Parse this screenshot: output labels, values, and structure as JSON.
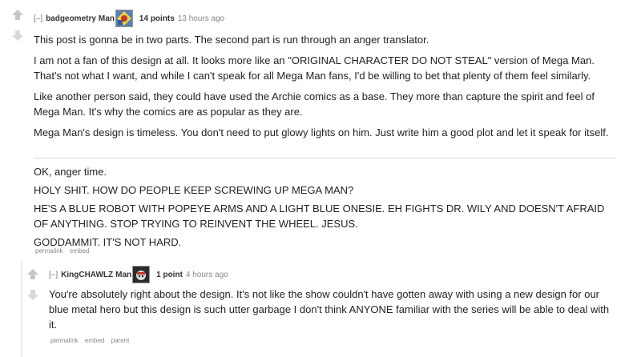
{
  "comment1": {
    "expand": "[–]",
    "author": "badgeometry",
    "flair_text": "Man",
    "score": "14 points",
    "time": "13 hours ago",
    "paragraphs": [
      "This post is gonna be in two parts. The second part is run through an anger translator.",
      "I am not a fan of this design at all. It looks more like an \"ORIGINAL CHARACTER DO NOT STEAL\" version of Mega Man. That's not what I want, and while I can't speak for all Mega Man fans, I'd be willing to bet that plenty of them feel similarly.",
      "Like another person said, they could have used the Archie comics as a base. They more than capture the spirit and feel of Mega Man. It's why the comics are as popular as they are.",
      "Mega Man's design is timeless. You don't need to put glowy lights on him. Just write him a good plot and let it speak for itself."
    ],
    "paragraphs2": [
      "OK, anger time.",
      "HOLY SHIT. HOW DO PEOPLE KEEP SCREWING UP MEGA MAN?",
      "HE'S A BLUE ROBOT WITH POPEYE ARMS AND A LIGHT BLUE ONESIE. EH FIGHTS DR. WILY AND DOESN'T AFRAID OF ANYTHING. STOP TRYING TO REINVENT THE WHEEL. JESUS.",
      "GODDAMMIT. IT'S NOT HARD."
    ],
    "buttons": [
      "permalink",
      "embed"
    ]
  },
  "comment2": {
    "expand": "[–]",
    "author": "KingCHAWLZ",
    "flair_text": "Man",
    "score": "1 point",
    "time": "4 hours ago",
    "paragraphs": [
      "You're absolutely right about the design. It's not like the show couldn't have gotten away with using a new design for our blue metal hero but this design is such utter garbage I don't think ANYONE familiar with the series will be able to deal with it."
    ],
    "buttons": [
      "permalink",
      "embed",
      "parent"
    ]
  }
}
